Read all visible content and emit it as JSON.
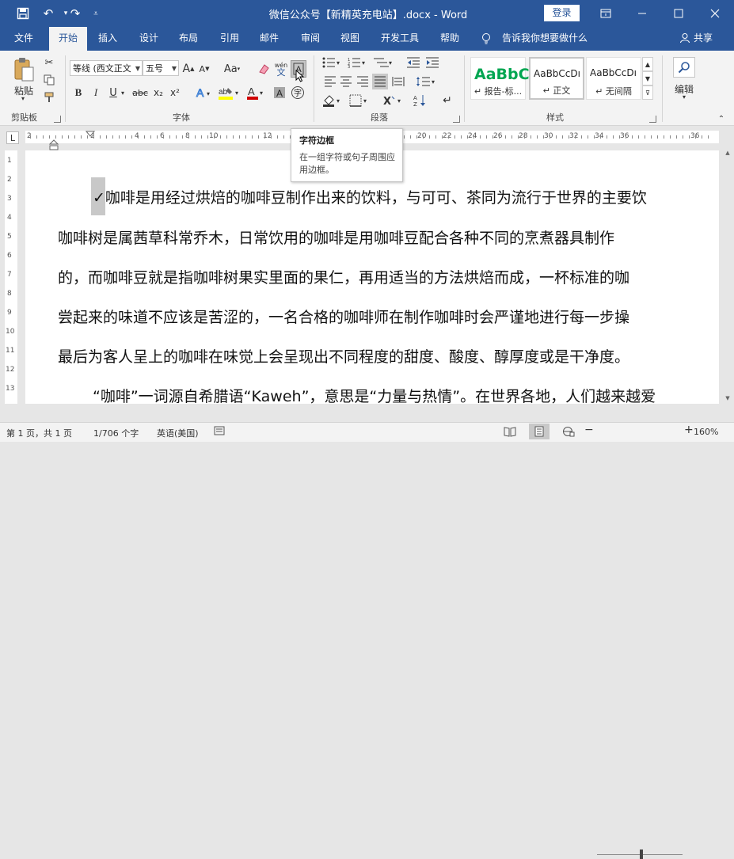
{
  "title_bar": {
    "document_title": "微信公众号【新精英充电站】.docx  -  Word",
    "login_label": "登录",
    "save_icon": "save-icon",
    "undo_icon": "undo-icon",
    "redo_icon": "redo-icon",
    "customize_icon": "customize-qat-icon"
  },
  "tabs": [
    {
      "label": "文件"
    },
    {
      "label": "开始"
    },
    {
      "label": "插入"
    },
    {
      "label": "设计"
    },
    {
      "label": "布局"
    },
    {
      "label": "引用"
    },
    {
      "label": "邮件"
    },
    {
      "label": "审阅"
    },
    {
      "label": "视图"
    },
    {
      "label": "开发工具"
    },
    {
      "label": "帮助"
    }
  ],
  "tell_me": "告诉我你想要做什么",
  "share_label": "共享",
  "ribbon": {
    "clipboard": {
      "label": "剪贴板",
      "paste_label": "粘贴"
    },
    "font": {
      "label": "字体",
      "font_name": "等线 (西文正文",
      "font_size": "五号",
      "bold": "B",
      "italic": "I",
      "underline": "U",
      "strike": "abc",
      "subscript": "x₂",
      "superscript": "x²",
      "grow": "A",
      "shrink": "A",
      "case": "Aa",
      "phonetic": "wén"
    },
    "paragraph": {
      "label": "段落"
    },
    "styles": {
      "label": "样式",
      "items": [
        {
          "sample": "AaBbC",
          "name": "↵ 报告-标..."
        },
        {
          "sample": "AaBbCcDı",
          "name": "↵ 正文"
        },
        {
          "sample": "AaBbCcDı",
          "name": "↵ 无间隔"
        }
      ]
    },
    "editing": {
      "label": "编辑"
    }
  },
  "ruler_numbers": [
    "2",
    "2",
    "4",
    "6",
    "8",
    "10",
    "12",
    "14",
    "16",
    "18",
    "20",
    "22",
    "24",
    "26",
    "28",
    "30",
    "32",
    "34",
    "36"
  ],
  "vruler_numbers": [
    "1",
    "2",
    "3",
    "4",
    "5",
    "6",
    "7",
    "8",
    "9",
    "10",
    "11",
    "12",
    "13"
  ],
  "tooltip": {
    "title": "字符边框",
    "description": "在一组字符或句子周围应用边框。"
  },
  "document": {
    "paragraphs": [
      "✓咖啡是用经过烘焙的咖啡豆制作出来的饮料，与可可、茶同为流行于世界的主要饮",
      "咖啡树是属茜草科常乔木，日常饮用的咖啡是用咖啡豆配合各种不同的烹煮器具制作",
      "的，而咖啡豆就是指咖啡树果实里面的果仁，再用适当的方法烘焙而成，一杯标准的咖",
      "尝起来的味道不应该是苦涩的，一名合格的咖啡师在制作咖啡时会严谨地进行每一步操",
      "最后为客人呈上的咖啡在味觉上会呈现出不同程度的甜度、酸度、醇厚度或是干净度。",
      "“咖啡”一词源自希腊语“Kaweh”，意思是“力量与热情”。在世界各地，人们越来越爱"
    ]
  },
  "status_bar": {
    "page": "第 1 页，共 1 页",
    "words": "1/706 个字",
    "language": "英语(美国)",
    "zoom": "160%"
  },
  "colors": {
    "accent": "#2b579a",
    "ribbon_bg": "#f3f3f3",
    "highlight": "#ffff00",
    "font_color": "#d00000",
    "style_green": "#00a651"
  }
}
